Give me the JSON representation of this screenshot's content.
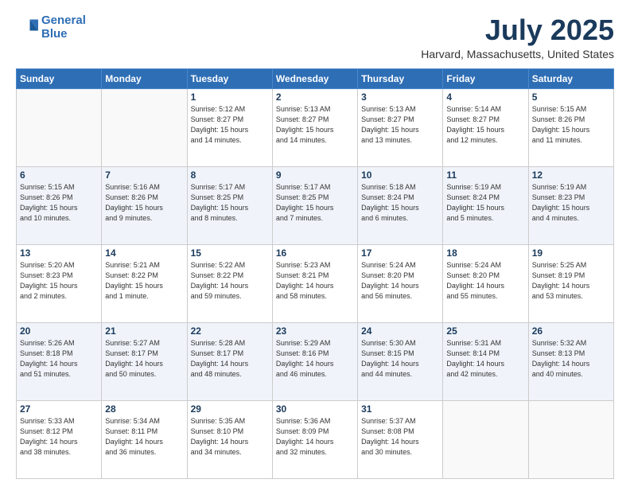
{
  "header": {
    "logo_line1": "General",
    "logo_line2": "Blue",
    "month": "July 2025",
    "location": "Harvard, Massachusetts, United States"
  },
  "days_of_week": [
    "Sunday",
    "Monday",
    "Tuesday",
    "Wednesday",
    "Thursday",
    "Friday",
    "Saturday"
  ],
  "weeks": [
    [
      {
        "day": "",
        "info": ""
      },
      {
        "day": "",
        "info": ""
      },
      {
        "day": "1",
        "info": "Sunrise: 5:12 AM\nSunset: 8:27 PM\nDaylight: 15 hours\nand 14 minutes."
      },
      {
        "day": "2",
        "info": "Sunrise: 5:13 AM\nSunset: 8:27 PM\nDaylight: 15 hours\nand 14 minutes."
      },
      {
        "day": "3",
        "info": "Sunrise: 5:13 AM\nSunset: 8:27 PM\nDaylight: 15 hours\nand 13 minutes."
      },
      {
        "day": "4",
        "info": "Sunrise: 5:14 AM\nSunset: 8:27 PM\nDaylight: 15 hours\nand 12 minutes."
      },
      {
        "day": "5",
        "info": "Sunrise: 5:15 AM\nSunset: 8:26 PM\nDaylight: 15 hours\nand 11 minutes."
      }
    ],
    [
      {
        "day": "6",
        "info": "Sunrise: 5:15 AM\nSunset: 8:26 PM\nDaylight: 15 hours\nand 10 minutes."
      },
      {
        "day": "7",
        "info": "Sunrise: 5:16 AM\nSunset: 8:26 PM\nDaylight: 15 hours\nand 9 minutes."
      },
      {
        "day": "8",
        "info": "Sunrise: 5:17 AM\nSunset: 8:25 PM\nDaylight: 15 hours\nand 8 minutes."
      },
      {
        "day": "9",
        "info": "Sunrise: 5:17 AM\nSunset: 8:25 PM\nDaylight: 15 hours\nand 7 minutes."
      },
      {
        "day": "10",
        "info": "Sunrise: 5:18 AM\nSunset: 8:24 PM\nDaylight: 15 hours\nand 6 minutes."
      },
      {
        "day": "11",
        "info": "Sunrise: 5:19 AM\nSunset: 8:24 PM\nDaylight: 15 hours\nand 5 minutes."
      },
      {
        "day": "12",
        "info": "Sunrise: 5:19 AM\nSunset: 8:23 PM\nDaylight: 15 hours\nand 4 minutes."
      }
    ],
    [
      {
        "day": "13",
        "info": "Sunrise: 5:20 AM\nSunset: 8:23 PM\nDaylight: 15 hours\nand 2 minutes."
      },
      {
        "day": "14",
        "info": "Sunrise: 5:21 AM\nSunset: 8:22 PM\nDaylight: 15 hours\nand 1 minute."
      },
      {
        "day": "15",
        "info": "Sunrise: 5:22 AM\nSunset: 8:22 PM\nDaylight: 14 hours\nand 59 minutes."
      },
      {
        "day": "16",
        "info": "Sunrise: 5:23 AM\nSunset: 8:21 PM\nDaylight: 14 hours\nand 58 minutes."
      },
      {
        "day": "17",
        "info": "Sunrise: 5:24 AM\nSunset: 8:20 PM\nDaylight: 14 hours\nand 56 minutes."
      },
      {
        "day": "18",
        "info": "Sunrise: 5:24 AM\nSunset: 8:20 PM\nDaylight: 14 hours\nand 55 minutes."
      },
      {
        "day": "19",
        "info": "Sunrise: 5:25 AM\nSunset: 8:19 PM\nDaylight: 14 hours\nand 53 minutes."
      }
    ],
    [
      {
        "day": "20",
        "info": "Sunrise: 5:26 AM\nSunset: 8:18 PM\nDaylight: 14 hours\nand 51 minutes."
      },
      {
        "day": "21",
        "info": "Sunrise: 5:27 AM\nSunset: 8:17 PM\nDaylight: 14 hours\nand 50 minutes."
      },
      {
        "day": "22",
        "info": "Sunrise: 5:28 AM\nSunset: 8:17 PM\nDaylight: 14 hours\nand 48 minutes."
      },
      {
        "day": "23",
        "info": "Sunrise: 5:29 AM\nSunset: 8:16 PM\nDaylight: 14 hours\nand 46 minutes."
      },
      {
        "day": "24",
        "info": "Sunrise: 5:30 AM\nSunset: 8:15 PM\nDaylight: 14 hours\nand 44 minutes."
      },
      {
        "day": "25",
        "info": "Sunrise: 5:31 AM\nSunset: 8:14 PM\nDaylight: 14 hours\nand 42 minutes."
      },
      {
        "day": "26",
        "info": "Sunrise: 5:32 AM\nSunset: 8:13 PM\nDaylight: 14 hours\nand 40 minutes."
      }
    ],
    [
      {
        "day": "27",
        "info": "Sunrise: 5:33 AM\nSunset: 8:12 PM\nDaylight: 14 hours\nand 38 minutes."
      },
      {
        "day": "28",
        "info": "Sunrise: 5:34 AM\nSunset: 8:11 PM\nDaylight: 14 hours\nand 36 minutes."
      },
      {
        "day": "29",
        "info": "Sunrise: 5:35 AM\nSunset: 8:10 PM\nDaylight: 14 hours\nand 34 minutes."
      },
      {
        "day": "30",
        "info": "Sunrise: 5:36 AM\nSunset: 8:09 PM\nDaylight: 14 hours\nand 32 minutes."
      },
      {
        "day": "31",
        "info": "Sunrise: 5:37 AM\nSunset: 8:08 PM\nDaylight: 14 hours\nand 30 minutes."
      },
      {
        "day": "",
        "info": ""
      },
      {
        "day": "",
        "info": ""
      }
    ]
  ]
}
